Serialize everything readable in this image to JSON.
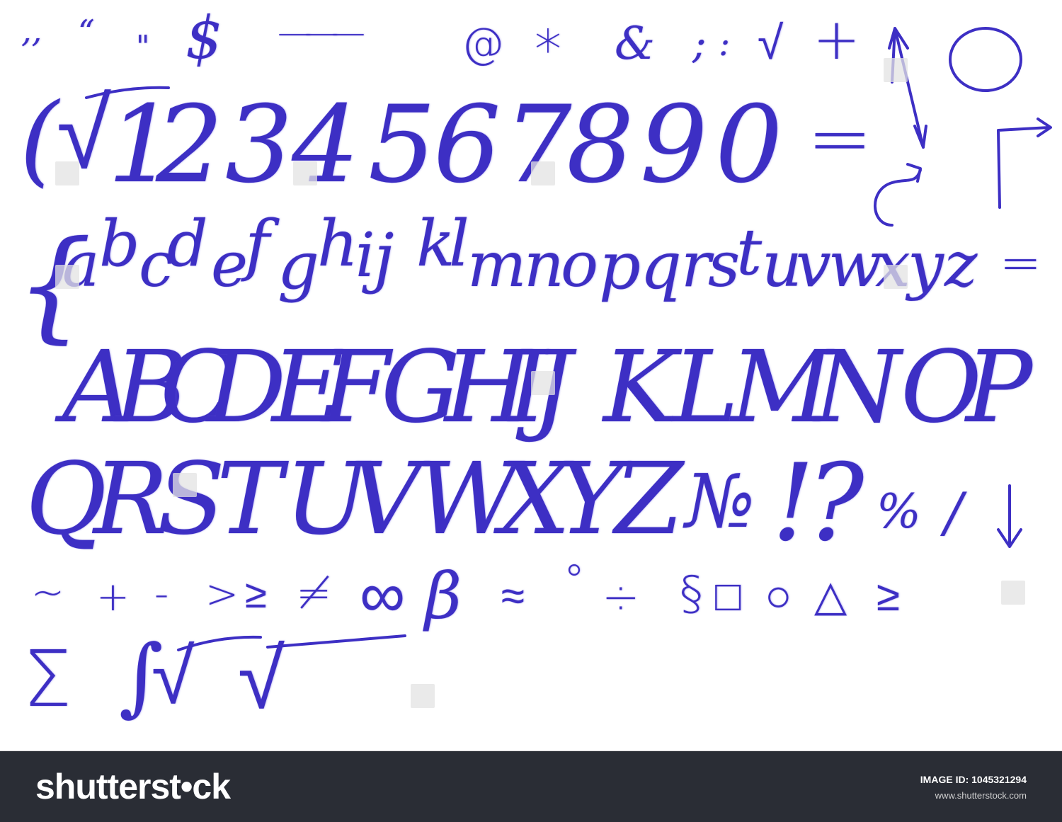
{
  "rows": [
    {
      "name": "punctuation-row",
      "glyphs": [
        ",,",
        "“",
        "\"",
        "$",
        "———",
        "@",
        "*",
        "&",
        ";",
        ":",
        "√",
        "+"
      ]
    },
    {
      "name": "digits-row",
      "glyphs": [
        "(",
        "√",
        "1",
        "2",
        "3",
        "4",
        "5",
        "6",
        "7",
        "8",
        "9",
        "0",
        "="
      ]
    },
    {
      "name": "lowercase-row",
      "glyphs": [
        "{",
        "a",
        "b",
        "c",
        "d",
        "e",
        "f",
        "g",
        "h",
        "i",
        "j",
        "k",
        "l",
        "m",
        "n",
        "o",
        "p",
        "q",
        "r",
        "s",
        "t",
        "u",
        "v",
        "w",
        "x",
        "y",
        "z",
        "="
      ]
    },
    {
      "name": "uppercase-row-1",
      "glyphs": [
        "A",
        "B",
        "C",
        "D",
        "E",
        "F",
        "G",
        "H",
        "I",
        "J",
        "K",
        "L",
        "M",
        "N",
        "O",
        "P"
      ]
    },
    {
      "name": "uppercase-row-2",
      "glyphs": [
        "Q",
        "R",
        "S",
        "T",
        "U",
        "V",
        "W",
        "X",
        "Y",
        "Z",
        "№",
        "!",
        "?",
        "%",
        "/"
      ]
    },
    {
      "name": "math-row",
      "glyphs": [
        "~",
        "+",
        "-",
        ">",
        "≥",
        "≠",
        "∞",
        "β",
        "≈",
        "°",
        "÷",
        "§",
        "□",
        "○",
        "△",
        "≥"
      ]
    },
    {
      "name": "math-row-2",
      "glyphs": [
        "Σ",
        "∫",
        "√",
        "√"
      ]
    }
  ],
  "footer": {
    "logo": "shutterst•ck",
    "image_id": "IMAGE ID: 1045321294",
    "site": "www.shutterstock.com"
  },
  "colors": {
    "ink": "#3d2fc4",
    "footer_bg": "#2a2d35",
    "canvas": "#ffffff"
  },
  "icons": {
    "arrow_up": "arrow-up-icon",
    "circle": "circle-icon",
    "arrow_right": "arrow-right-icon",
    "curved_arrow": "curved-arrow-icon",
    "arrow_down": "arrow-down-icon"
  }
}
